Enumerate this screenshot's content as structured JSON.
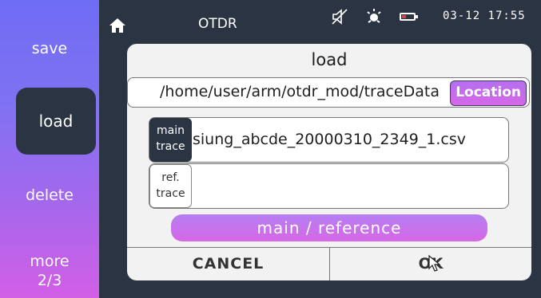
{
  "sidebar": {
    "items": [
      {
        "label": "save"
      },
      {
        "label": "load"
      },
      {
        "label": "delete"
      },
      {
        "label": "more",
        "sub": "2/3"
      }
    ]
  },
  "topbar": {
    "title": "OTDR",
    "datetime": "03-12 17:55",
    "icons": [
      "home-icon",
      "speaker-muted-icon",
      "brightness-icon",
      "battery-icon"
    ],
    "battery_color": "#e83a3a"
  },
  "dialog": {
    "title": "load",
    "path": "/home/user/arm/otdr_mod/traceData",
    "location_label": "Location",
    "main_trace": {
      "tag": [
        "main",
        "trace"
      ],
      "file": "siung_abcde_20000310_2349_1.csv"
    },
    "ref_trace": {
      "tag": [
        "ref.",
        "trace"
      ],
      "file": ""
    },
    "toggle_label": "main / reference",
    "cancel_label": "CANCEL",
    "ok_label": "OK"
  },
  "colors": {
    "accent_purple": "#b56ff0",
    "sidebar_gradient_top": "#6f6cf4",
    "sidebar_gradient_bottom": "#d25fe6",
    "background": "#2b3443"
  }
}
